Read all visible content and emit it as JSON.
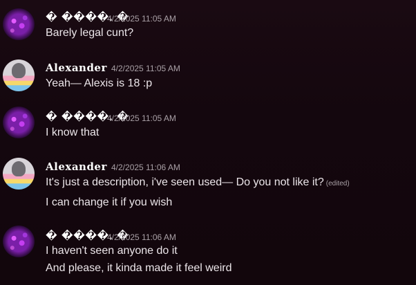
{
  "messages": [
    {
      "author": "� ����. �",
      "timestamp": "4/2/2025 11:05 AM",
      "lines": [
        "Barely legal cunt?"
      ],
      "edited_label": ""
    },
    {
      "author": "Alexander",
      "timestamp": "4/2/2025 11:05 AM",
      "lines": [
        "Yeah— Alexis is 18 :p"
      ],
      "edited_label": ""
    },
    {
      "author": "� ����. �",
      "timestamp": "4/2/2025 11:05 AM",
      "lines": [
        "I know that"
      ],
      "edited_label": ""
    },
    {
      "author": "Alexander",
      "timestamp": "4/2/2025 11:06 AM",
      "lines": [
        "It's just a description, i've seen used— Do you not like it?",
        "I can change it if you wish"
      ],
      "edited_label": "(edited)"
    },
    {
      "author": "� ����. �",
      "timestamp": "4/2/2025 11:06 AM",
      "lines": [
        "I haven't seen anyone do it",
        "And please, it kinda made it feel weird"
      ],
      "edited_label": ""
    }
  ]
}
